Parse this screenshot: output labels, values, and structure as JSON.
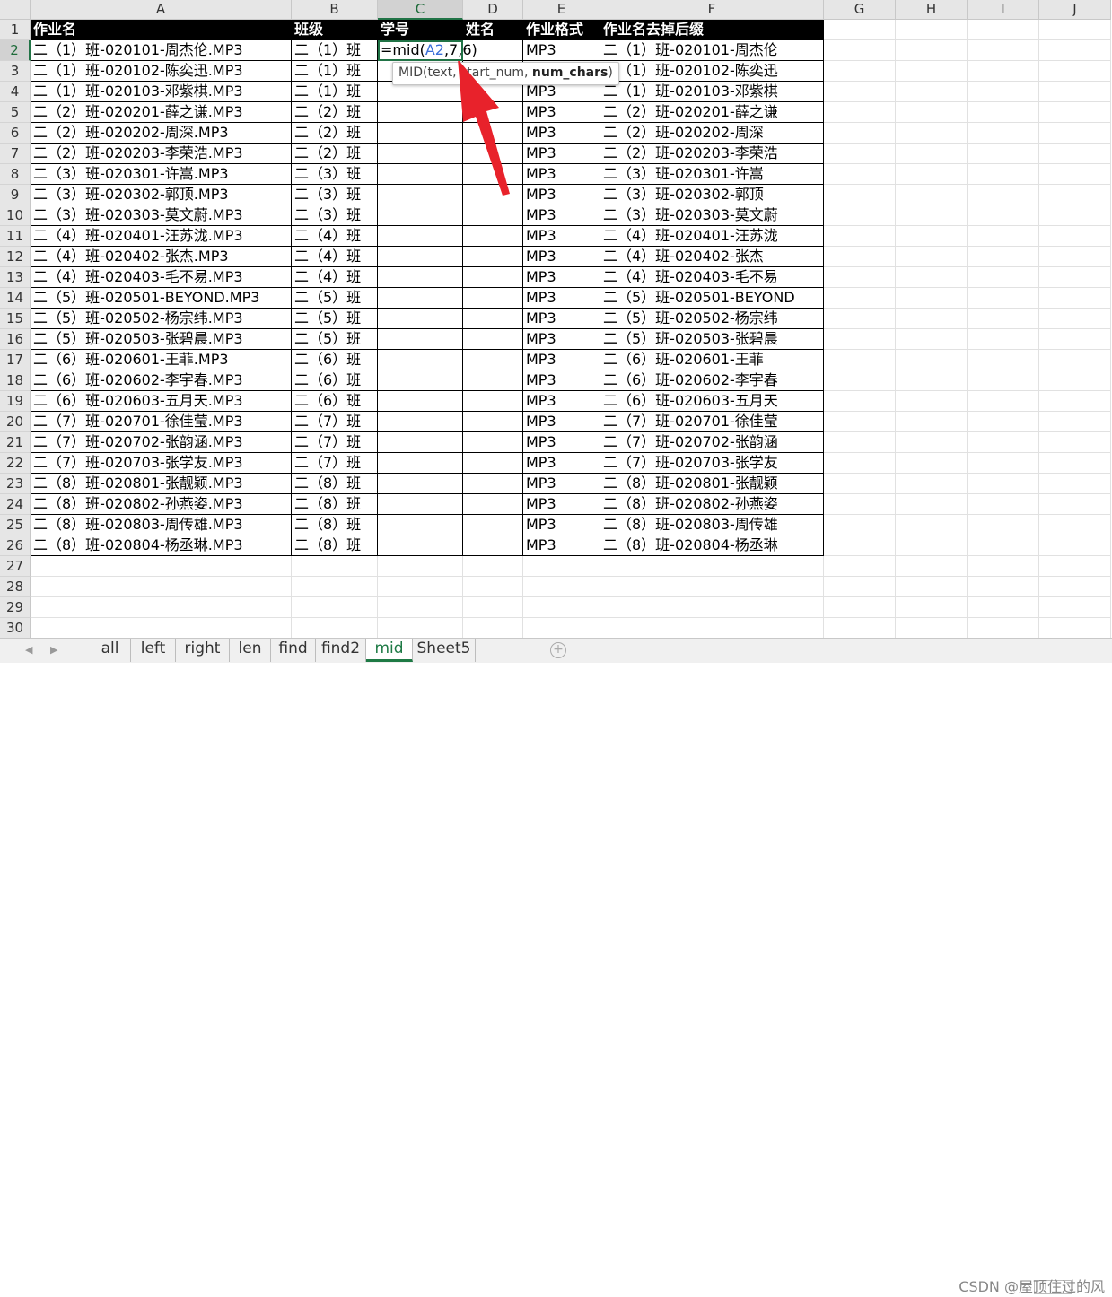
{
  "columns": [
    "A",
    "B",
    "C",
    "D",
    "E",
    "F",
    "G",
    "H",
    "I",
    "J"
  ],
  "row_numbers": [
    "1",
    "2",
    "3",
    "4",
    "5",
    "6",
    "7",
    "8",
    "9",
    "10",
    "11",
    "12",
    "13",
    "14",
    "15",
    "16",
    "17",
    "18",
    "19",
    "20",
    "21",
    "22",
    "23",
    "24",
    "25",
    "26",
    "27",
    "28",
    "29",
    "30"
  ],
  "headers": {
    "A": "作业名",
    "B": "班级",
    "C": "学号",
    "D": "姓名",
    "E": "作业格式",
    "F": "作业名去掉后缀"
  },
  "active_cell": {
    "ref": "C2",
    "formula_prefix": "=mid(",
    "formula_ref": "A2",
    "formula_suffix": ",7,6)"
  },
  "tooltip": {
    "prefix": "MID(text, ",
    "middle": "start_num, ",
    "bold": "num_chars",
    "suffix": ")"
  },
  "rows": [
    {
      "A": "二（1）班-020101-周杰伦.MP3",
      "B": "二（1）班",
      "E": "",
      "F": "二（1）班-020101-周杰伦"
    },
    {
      "A": "二（1）班-020102-陈奕迅.MP3",
      "B": "二（1）班",
      "E": "",
      "F": "二（1）班-020102-陈奕迅"
    },
    {
      "A": "二（1）班-020103-邓紫棋.MP3",
      "B": "二（1）班",
      "E": "MP3",
      "F": "二（1）班-020103-邓紫棋"
    },
    {
      "A": "二（2）班-020201-薛之谦.MP3",
      "B": "二（2）班",
      "E": "MP3",
      "F": "二（2）班-020201-薛之谦"
    },
    {
      "A": "二（2）班-020202-周深.MP3",
      "B": "二（2）班",
      "E": "MP3",
      "F": "二（2）班-020202-周深"
    },
    {
      "A": "二（2）班-020203-李荣浩.MP3",
      "B": "二（2）班",
      "E": "MP3",
      "F": "二（2）班-020203-李荣浩"
    },
    {
      "A": "二（3）班-020301-许嵩.MP3",
      "B": "二（3）班",
      "E": "MP3",
      "F": "二（3）班-020301-许嵩"
    },
    {
      "A": "二（3）班-020302-郭顶.MP3",
      "B": "二（3）班",
      "E": "MP3",
      "F": "二（3）班-020302-郭顶"
    },
    {
      "A": "二（3）班-020303-莫文蔚.MP3",
      "B": "二（3）班",
      "E": "MP3",
      "F": "二（3）班-020303-莫文蔚"
    },
    {
      "A": "二（4）班-020401-汪苏泷.MP3",
      "B": "二（4）班",
      "E": "MP3",
      "F": "二（4）班-020401-汪苏泷"
    },
    {
      "A": "二（4）班-020402-张杰.MP3",
      "B": "二（4）班",
      "E": "MP3",
      "F": "二（4）班-020402-张杰"
    },
    {
      "A": "二（4）班-020403-毛不易.MP3",
      "B": "二（4）班",
      "E": "MP3",
      "F": "二（4）班-020403-毛不易"
    },
    {
      "A": "二（5）班-020501-BEYOND.MP3",
      "B": "二（5）班",
      "E": "MP3",
      "F": "二（5）班-020501-BEYOND"
    },
    {
      "A": "二（5）班-020502-杨宗纬.MP3",
      "B": "二（5）班",
      "E": "MP3",
      "F": "二（5）班-020502-杨宗纬"
    },
    {
      "A": "二（5）班-020503-张碧晨.MP3",
      "B": "二（5）班",
      "E": "MP3",
      "F": "二（5）班-020503-张碧晨"
    },
    {
      "A": "二（6）班-020601-王菲.MP3",
      "B": "二（6）班",
      "E": "MP3",
      "F": "二（6）班-020601-王菲"
    },
    {
      "A": "二（6）班-020602-李宇春.MP3",
      "B": "二（6）班",
      "E": "MP3",
      "F": "二（6）班-020602-李宇春"
    },
    {
      "A": "二（6）班-020603-五月天.MP3",
      "B": "二（6）班",
      "E": "MP3",
      "F": "二（6）班-020603-五月天"
    },
    {
      "A": "二（7）班-020701-徐佳莹.MP3",
      "B": "二（7）班",
      "E": "MP3",
      "F": "二（7）班-020701-徐佳莹"
    },
    {
      "A": "二（7）班-020702-张韵涵.MP3",
      "B": "二（7）班",
      "E": "MP3",
      "F": "二（7）班-020702-张韵涵"
    },
    {
      "A": "二（7）班-020703-张学友.MP3",
      "B": "二（7）班",
      "E": "MP3",
      "F": "二（7）班-020703-张学友"
    },
    {
      "A": "二（8）班-020801-张靓颖.MP3",
      "B": "二（8）班",
      "E": "MP3",
      "F": "二（8）班-020801-张靓颖"
    },
    {
      "A": "二（8）班-020802-孙燕姿.MP3",
      "B": "二（8）班",
      "E": "MP3",
      "F": "二（8）班-020802-孙燕姿"
    },
    {
      "A": "二（8）班-020803-周传雄.MP3",
      "B": "二（8）班",
      "E": "MP3",
      "F": "二（8）班-020803-周传雄"
    },
    {
      "A": "二（8）班-020804-杨丞琳.MP3",
      "B": "二（8）班",
      "E": "MP3",
      "F": "二（8）班-020804-杨丞琳"
    }
  ],
  "e_row2": "MP3",
  "sheet_tabs": [
    "all",
    "left",
    "right",
    "len",
    "find",
    "find2",
    "mid",
    "Sheet5"
  ],
  "active_tab": "mid",
  "add_sheet_glyph": "+",
  "nav_left": "◀",
  "nav_right": "▶",
  "watermark": "CSDN @屋顶住过的风",
  "colors": {
    "accent": "#217346",
    "header_bg": "#000000",
    "arrow": "#e8222b"
  }
}
